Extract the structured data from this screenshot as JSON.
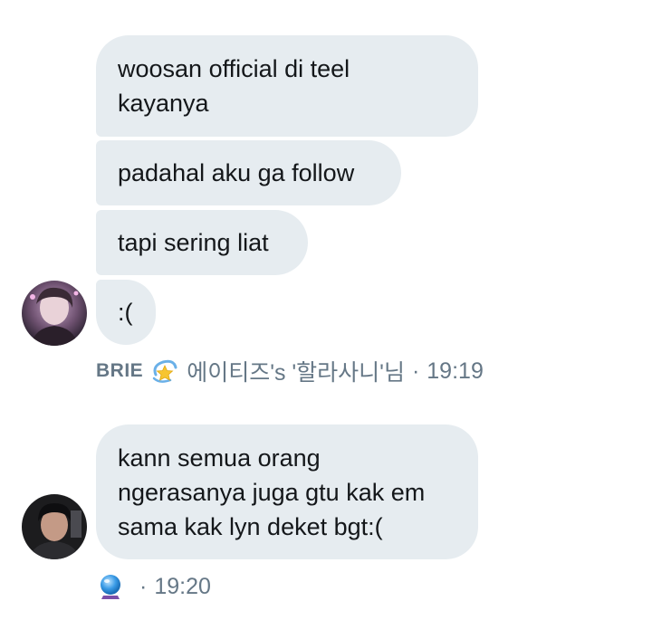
{
  "thread": {
    "group1": {
      "messages": [
        {
          "text": "woosan official di teel\nkayanya"
        },
        {
          "text": "padahal aku ga follow"
        },
        {
          "text": "tapi sering liat"
        },
        {
          "text": ":("
        }
      ],
      "meta": {
        "sender": "BRIE",
        "emoji_icon": "dizzy-star-icon",
        "nickname": "에이티즈's '할라사니'님",
        "separator": "·",
        "time": "19:19"
      }
    },
    "group2": {
      "messages": [
        {
          "text": "kann semua orang\nngerasanya juga gtu kak em\nsama kak lyn deket bgt:("
        }
      ],
      "meta": {
        "emoji_icon": "crystal-ball-icon",
        "separator": "·",
        "time": "19:20"
      }
    }
  },
  "colors": {
    "bubble_bg": "#e6ecf0",
    "text": "#14171a",
    "meta": "#657786"
  }
}
